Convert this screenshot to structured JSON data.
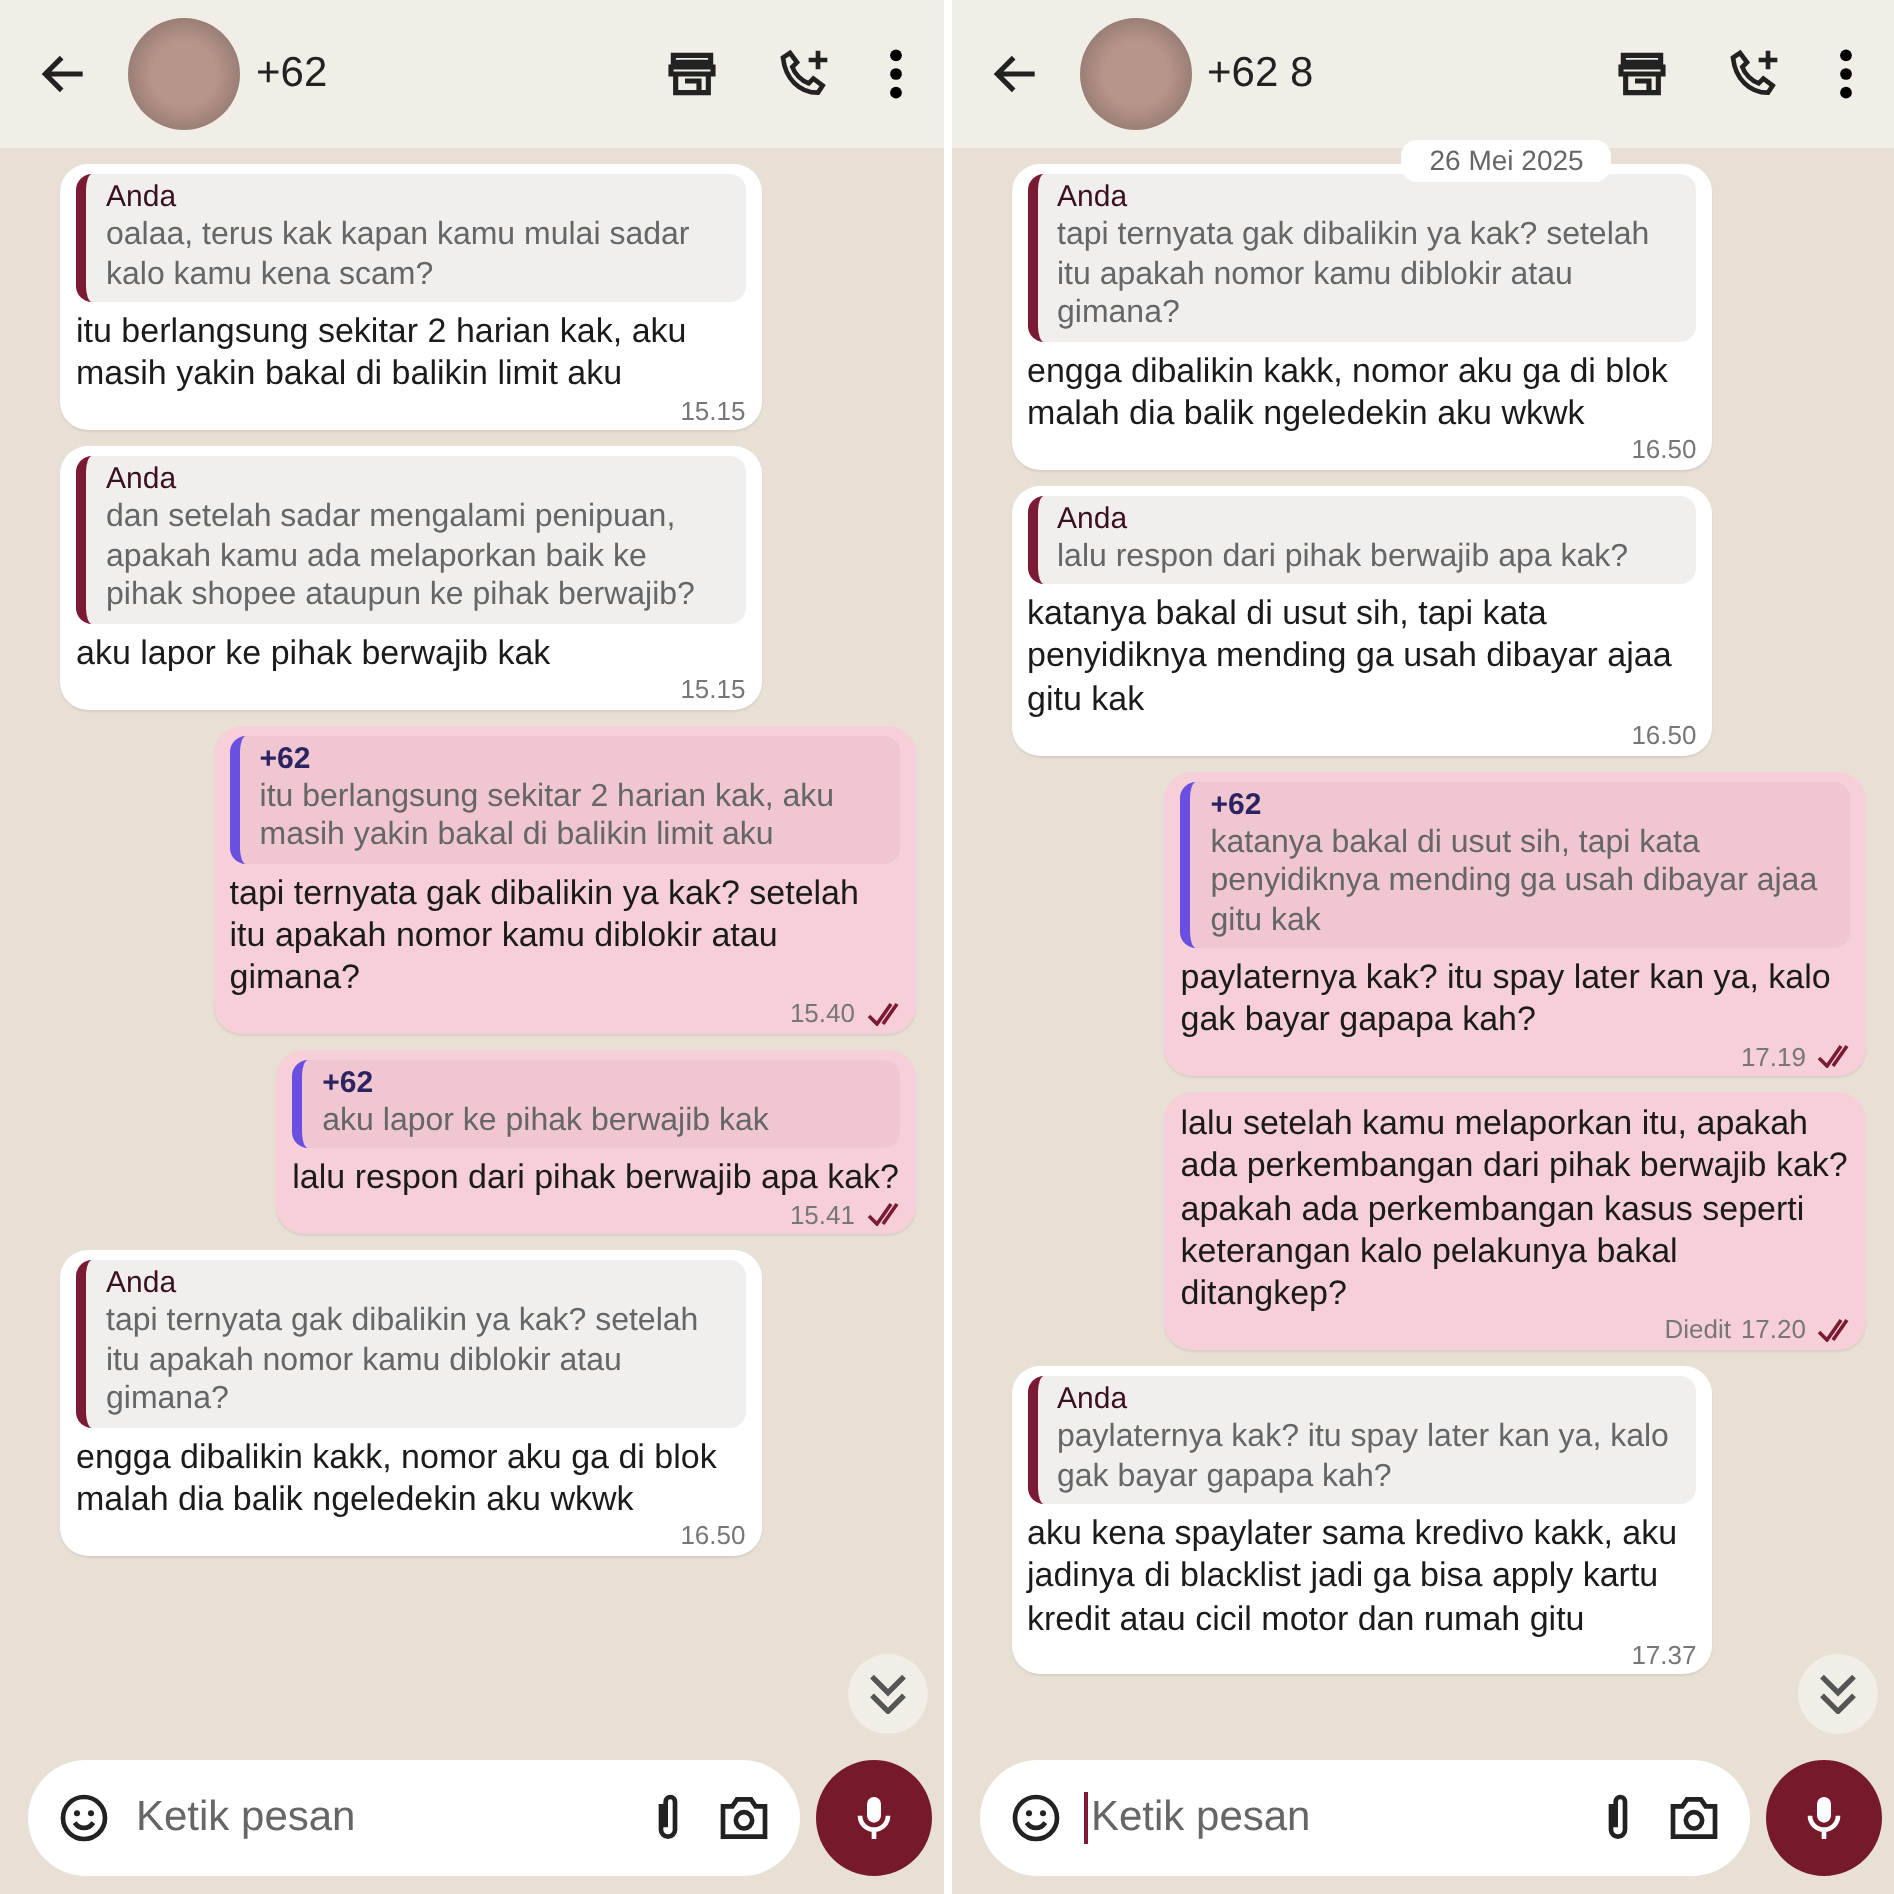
{
  "screens": [
    {
      "header": {
        "contact": "+62"
      },
      "composer": {
        "placeholder": "Ketik pesan",
        "focused": false
      },
      "messages": [
        {
          "kind": "in",
          "quote": {
            "author": "Anda",
            "text": "oalaa, terus kak kapan kamu mulai sadar kalo kamu kena scam?"
          },
          "text": "itu berlangsung sekitar 2 harian kak, aku masih yakin bakal di balikin limit aku",
          "time": "15.15"
        },
        {
          "kind": "in",
          "quote": {
            "author": "Anda",
            "text": "dan setelah sadar mengalami penipuan, apakah kamu ada melaporkan baik ke pihak shopee ataupun ke pihak berwajib?"
          },
          "text": "aku lapor ke pihak berwajib kak",
          "time": "15.15"
        },
        {
          "kind": "out",
          "quote": {
            "author": "+62",
            "text": "itu berlangsung sekitar 2 harian kak, aku masih yakin bakal di balikin limit aku"
          },
          "text": "tapi ternyata gak dibalikin ya kak? setelah itu apakah nomor kamu diblokir atau gimana?",
          "time": "15.40",
          "read": true
        },
        {
          "kind": "out",
          "quote": {
            "author": "+62",
            "text": "aku lapor ke pihak berwajib kak"
          },
          "text": "lalu respon dari pihak berwajib apa kak?",
          "time": "15.41",
          "read": true
        },
        {
          "kind": "in",
          "quote": {
            "author": "Anda",
            "text": "tapi ternyata gak dibalikin ya kak? setelah itu apakah nomor kamu diblokir atau gimana?"
          },
          "text": "engga dibalikin kakk, nomor aku ga di blok malah dia balik ngeledekin aku wkwk",
          "time": "16.50"
        }
      ]
    },
    {
      "header": {
        "contact": "+62 8"
      },
      "date_chip": "26 Mei 2025",
      "composer": {
        "placeholder": "Ketik pesan",
        "focused": true
      },
      "messages": [
        {
          "kind": "in",
          "quote": {
            "author": "Anda",
            "text": "tapi ternyata gak dibalikin ya kak? setelah itu apakah nomor kamu diblokir atau gimana?"
          },
          "text": "engga dibalikin kakk, nomor aku ga di blok malah dia balik ngeledekin aku wkwk",
          "time": "16.50"
        },
        {
          "kind": "in",
          "quote": {
            "author": "Anda",
            "text": "lalu respon dari pihak berwajib apa kak?"
          },
          "text": "katanya bakal di usut sih, tapi kata penyidiknya mending ga usah dibayar ajaa gitu kak",
          "time": "16.50"
        },
        {
          "kind": "out",
          "quote": {
            "author": "+62",
            "text": "katanya bakal di usut sih, tapi kata penyidiknya mending ga usah dibayar ajaa gitu kak"
          },
          "text": "paylaternya kak? itu spay later kan ya, kalo gak bayar gapapa kah?",
          "time": "17.19",
          "read": true
        },
        {
          "kind": "out",
          "edited": "Diedit",
          "text": "lalu setelah kamu melaporkan itu, apakah ada perkembangan dari pihak berwajib kak? apakah ada perkembangan kasus seperti keterangan kalo pelakunya bakal ditangkep?",
          "time": "17.20",
          "read": true
        },
        {
          "kind": "in",
          "quote": {
            "author": "Anda",
            "text": "paylaternya kak? itu spay later kan ya, kalo gak bayar gapapa kah?"
          },
          "text": "aku kena spaylater sama kredivo kakk, aku jadinya di blacklist jadi ga bisa apply kartu kredit atau cicil motor dan rumah gitu",
          "time": "17.37"
        }
      ]
    }
  ]
}
